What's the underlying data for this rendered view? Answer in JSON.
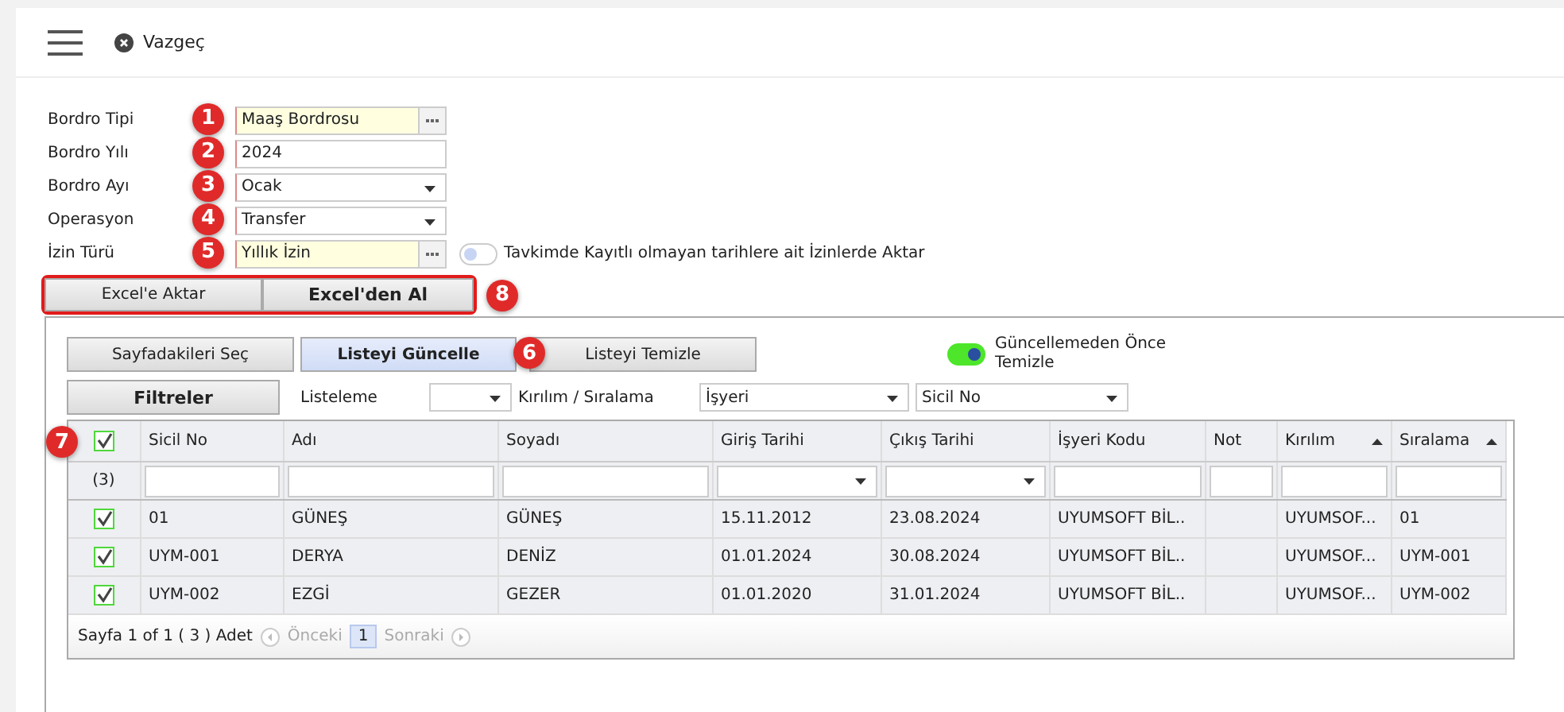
{
  "header": {
    "cancel": "Vazgeç"
  },
  "form": [
    {
      "label": "Bordro Tipi",
      "value": "Maaş Bordrosu",
      "kind": "lookup",
      "marker": "1"
    },
    {
      "label": "Bordro Yılı",
      "value": "2024",
      "kind": "text",
      "marker": "2"
    },
    {
      "label": "Bordro Ayı",
      "value": "Ocak",
      "kind": "select",
      "marker": "3"
    },
    {
      "label": "Operasyon",
      "value": "Transfer",
      "kind": "select",
      "marker": "4"
    },
    {
      "label": "İzin Türü",
      "value": "Yıllık İzin",
      "kind": "lookup",
      "marker": "5"
    }
  ],
  "leave_toggle": {
    "on": false,
    "label": "Tavkimde Kayıtlı olmayan tarihlere ait İzinlerde Aktar"
  },
  "excel_buttons": [
    {
      "label": "Excel'e Aktar",
      "kind": "normal"
    },
    {
      "label": "Excel'den Al",
      "kind": "primary"
    }
  ],
  "excel_marker": "8",
  "list_buttons": [
    {
      "label": "Sayfadakileri Seç",
      "selected": false
    },
    {
      "label": "Listeyi Güncelle",
      "selected": true,
      "marker": "6"
    },
    {
      "label": "Listeyi Temizle",
      "selected": false
    }
  ],
  "clear_toggle": {
    "on": true,
    "label": "Güncellemeden Önce Temizle"
  },
  "filters_button": "Filtreler",
  "listing_label": "Listeleme",
  "break_label": "Kırılım / Sıralama",
  "break_select": "İşyeri",
  "sort_select": "Sicil No",
  "table": {
    "select_all": {
      "checked": true,
      "marker": "7"
    },
    "count": "(3)",
    "columns": [
      {
        "label": "Sicil No",
        "kind": "text",
        "sorted": false
      },
      {
        "label": "Adı",
        "kind": "text",
        "sorted": false
      },
      {
        "label": "Soyadı",
        "kind": "text",
        "sorted": false
      },
      {
        "label": "Giriş Tarihi",
        "kind": "date",
        "sorted": false
      },
      {
        "label": "Çıkış Tarihi",
        "kind": "date",
        "sorted": false
      },
      {
        "label": "İşyeri Kodu",
        "kind": "text",
        "sorted": false
      },
      {
        "label": "Not",
        "kind": "text",
        "sorted": false
      },
      {
        "label": "Kırılım",
        "kind": "text",
        "sorted": true
      },
      {
        "label": "Sıralama",
        "kind": "text",
        "sorted": true
      }
    ],
    "rows": [
      {
        "checked": true,
        "cells": [
          "01",
          "GÜNEŞ",
          "GÜNEŞ",
          "15.11.2012",
          "23.08.2024",
          "UYUMSOFT BİL..",
          null,
          "UYUMSOF...",
          "01"
        ]
      },
      {
        "checked": true,
        "cells": [
          "UYM-001",
          "DERYA",
          "DENİZ",
          "01.01.2024",
          "30.08.2024",
          "UYUMSOFT BİL..",
          null,
          "UYUMSOF...",
          "UYM-001"
        ]
      },
      {
        "checked": true,
        "cells": [
          "UYM-002",
          "EZGİ",
          "GEZER",
          "01.01.2020",
          "31.01.2024",
          "UYUMSOFT BİL..",
          null,
          "UYUMSOF...",
          "UYM-002"
        ]
      }
    ]
  },
  "pager": {
    "summary": "Sayfa 1 of 1 ( 3 ) Adet",
    "prev": "Önceki",
    "page": "1",
    "next": "Sonraki",
    "prev_disabled": true,
    "next_disabled": true
  }
}
